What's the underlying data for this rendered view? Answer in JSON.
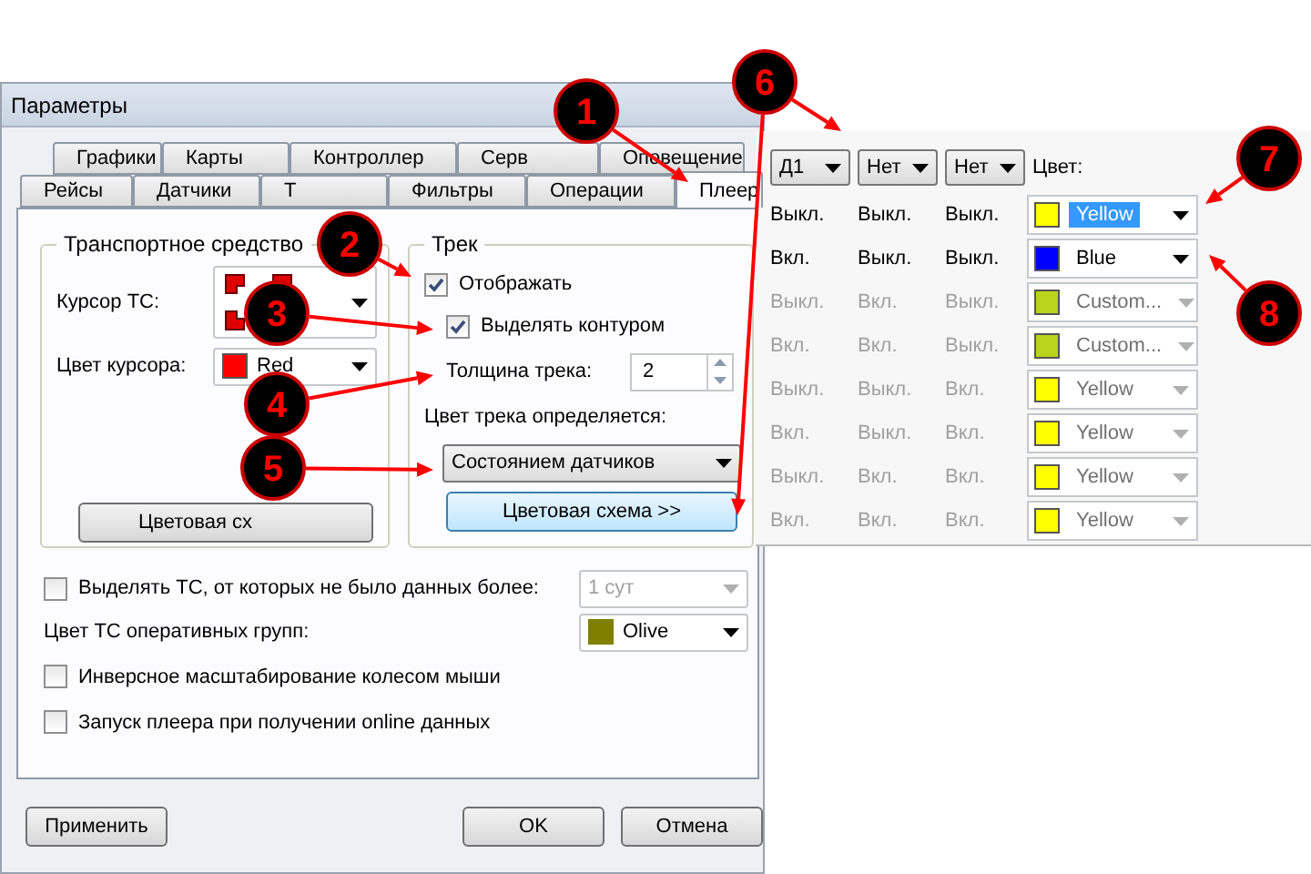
{
  "window": {
    "title": "Параметры"
  },
  "tab_rows": [
    {
      "tabs": [
        {
          "label": "Графики",
          "selected": false
        },
        {
          "label": "Карты",
          "selected": false
        },
        {
          "label": "Контроллер",
          "selected": false
        },
        {
          "label": "Серв",
          "selected": false
        },
        {
          "label": "Оповещение",
          "selected": false
        }
      ]
    },
    {
      "tabs": [
        {
          "label": "Рейсы",
          "selected": false
        },
        {
          "label": "Датчики",
          "selected": false
        },
        {
          "label": "Т",
          "selected": false
        },
        {
          "label": "Фильтры",
          "selected": false
        },
        {
          "label": "Операции",
          "selected": false
        },
        {
          "label": "Плеер",
          "selected": true
        }
      ]
    }
  ],
  "vehicle_group": {
    "title": "Транспортное средство",
    "cursor_label": "Курсор ТС:",
    "cursor_color_label": "Цвет курсора:",
    "cursor_color": {
      "name": "Red",
      "color": "#ff0000"
    },
    "scheme_button": "Цветовая сх"
  },
  "track_group": {
    "title": "Трек",
    "show": {
      "label": "Отображать",
      "checked": true
    },
    "outline": {
      "label": "Выделять контуром",
      "checked": true
    },
    "width_label": "Толщина трека:",
    "width_value": "2",
    "color_by_label": "Цвет трека определяется:",
    "color_by_value": "Состоянием датчиков",
    "scheme_button": "Цветовая схема >>"
  },
  "options": [
    {
      "kind": "checkbox",
      "label": "Выделять ТС, от которых не было данных более:",
      "checked": false,
      "select": {
        "value": "1 сут",
        "disabled": true
      }
    },
    {
      "kind": "color",
      "label": "Цвет ТС оперативных групп:",
      "select": {
        "value": "Olive",
        "color": "#808000",
        "disabled": false
      }
    },
    {
      "kind": "checkbox",
      "label": "Инверсное масштабирование колесом мыши",
      "checked": false
    },
    {
      "kind": "checkbox",
      "label": "Запуск плеера при получении online данных",
      "checked": false
    }
  ],
  "buttons": [
    "Применить",
    "OK",
    "Отмена"
  ],
  "color_scheme": {
    "headers": [
      "Д1",
      "Нет",
      "Нет"
    ],
    "color_label": "Цвет:",
    "rows": [
      {
        "states": [
          "Выкл.",
          "Выкл.",
          "Выкл."
        ],
        "enabled": true,
        "color": {
          "name": "Yellow",
          "color": "#ffff00",
          "selected": true
        }
      },
      {
        "states": [
          "Вкл.",
          "Выкл.",
          "Выкл."
        ],
        "enabled": true,
        "color": {
          "name": "Blue",
          "color": "#0000ff",
          "selected": false
        }
      },
      {
        "states": [
          "Выкл.",
          "Вкл.",
          "Выкл."
        ],
        "enabled": false,
        "color": {
          "name": "Custom...",
          "color": "#b8d41c",
          "selected": false
        }
      },
      {
        "states": [
          "Вкл.",
          "Вкл.",
          "Выкл."
        ],
        "enabled": false,
        "color": {
          "name": "Custom...",
          "color": "#b8d41c",
          "selected": false
        }
      },
      {
        "states": [
          "Выкл.",
          "Выкл.",
          "Вкл."
        ],
        "enabled": false,
        "color": {
          "name": "Yellow",
          "color": "#ffff00",
          "selected": false
        }
      },
      {
        "states": [
          "Вкл.",
          "Выкл.",
          "Вкл."
        ],
        "enabled": false,
        "color": {
          "name": "Yellow",
          "color": "#ffff00",
          "selected": false
        }
      },
      {
        "states": [
          "Выкл.",
          "Вкл.",
          "Вкл."
        ],
        "enabled": false,
        "color": {
          "name": "Yellow",
          "color": "#ffff00",
          "selected": false
        }
      },
      {
        "states": [
          "Вкл.",
          "Вкл.",
          "Вкл."
        ],
        "enabled": false,
        "color": {
          "name": "Yellow",
          "color": "#ffff00",
          "selected": false
        }
      }
    ]
  },
  "annotations": [
    {
      "number": "1"
    },
    {
      "number": "2"
    },
    {
      "number": "3"
    },
    {
      "number": "4"
    },
    {
      "number": "5"
    },
    {
      "number": "6"
    },
    {
      "number": "7"
    },
    {
      "number": "8"
    }
  ]
}
